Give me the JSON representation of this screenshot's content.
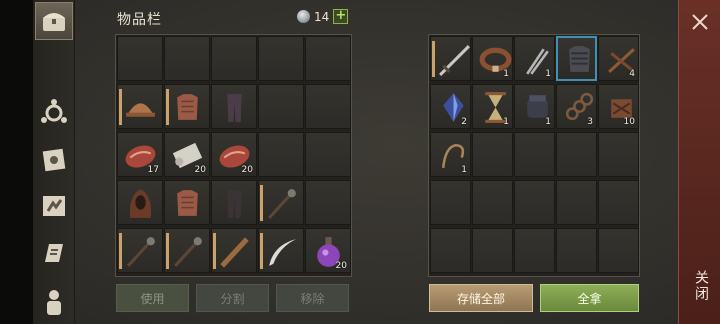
{
  "inventory": {
    "title": "物品栏",
    "coins": "14",
    "add_label": "+",
    "slots": [
      {
        "icon": "",
        "count": ""
      },
      {
        "icon": "",
        "count": ""
      },
      {
        "icon": "",
        "count": ""
      },
      {
        "icon": "",
        "count": ""
      },
      {
        "icon": "",
        "count": ""
      },
      {
        "icon": "leather-helmet-icon",
        "count": "",
        "equipped": true
      },
      {
        "icon": "leather-armor-icon",
        "count": "",
        "equipped": true
      },
      {
        "icon": "leather-pants-icon",
        "count": ""
      },
      {
        "icon": "",
        "count": ""
      },
      {
        "icon": "",
        "count": ""
      },
      {
        "icon": "raw-meat-icon",
        "count": "17"
      },
      {
        "icon": "cloth-roll-icon",
        "count": "20"
      },
      {
        "icon": "raw-meat-icon",
        "count": "20"
      },
      {
        "icon": "",
        "count": ""
      },
      {
        "icon": "",
        "count": ""
      },
      {
        "icon": "hood-icon",
        "count": ""
      },
      {
        "icon": "leather-armor-icon",
        "count": ""
      },
      {
        "icon": "dark-pants-icon",
        "count": ""
      },
      {
        "icon": "spiked-mace-icon",
        "count": "",
        "equipped": true
      },
      {
        "icon": "",
        "count": ""
      },
      {
        "icon": "spiked-mace-icon",
        "count": "",
        "equipped": true
      },
      {
        "icon": "spiked-mace-icon",
        "count": "",
        "equipped": true
      },
      {
        "icon": "wooden-club-icon",
        "count": "",
        "equipped": true
      },
      {
        "icon": "scimitar-icon",
        "count": "",
        "equipped": true
      },
      {
        "icon": "potion-icon",
        "count": "20"
      }
    ],
    "buttons": {
      "use": "使用",
      "split": "分割",
      "remove": "移除"
    }
  },
  "storage": {
    "slots": [
      {
        "icon": "sword-icon",
        "count": "",
        "equipped": true
      },
      {
        "icon": "leather-belt-icon",
        "count": "1"
      },
      {
        "icon": "tongs-icon",
        "count": "1"
      },
      {
        "icon": "chainmail-icon",
        "count": "",
        "selected": true
      },
      {
        "icon": "crossbow-bolt-icon",
        "count": "4"
      },
      {
        "icon": "crystal-icon",
        "count": "2"
      },
      {
        "icon": "hourglass-icon",
        "count": "1"
      },
      {
        "icon": "gauntlet-icon",
        "count": "1"
      },
      {
        "icon": "chain-icon",
        "count": "3"
      },
      {
        "icon": "scrap-icon",
        "count": "10"
      },
      {
        "icon": "rope-icon",
        "count": "1"
      },
      {
        "icon": "",
        "count": ""
      },
      {
        "icon": "",
        "count": ""
      },
      {
        "icon": "",
        "count": ""
      },
      {
        "icon": "",
        "count": ""
      },
      {
        "icon": "",
        "count": ""
      },
      {
        "icon": "",
        "count": ""
      },
      {
        "icon": "",
        "count": ""
      },
      {
        "icon": "",
        "count": ""
      },
      {
        "icon": "",
        "count": ""
      },
      {
        "icon": "",
        "count": ""
      },
      {
        "icon": "",
        "count": ""
      },
      {
        "icon": "",
        "count": ""
      },
      {
        "icon": "",
        "count": ""
      },
      {
        "icon": "",
        "count": ""
      }
    ],
    "buttons": {
      "store_all": "存储全部",
      "take_all": "全拿"
    }
  },
  "close": {
    "label": "关闭"
  },
  "nav": [
    "chest-icon",
    "crafting-icon",
    "sun-book-icon",
    "map-icon",
    "scroll-icon",
    "character-icon"
  ],
  "colors": {
    "accent_green": "#8fae58",
    "accent_tan": "#b89c74",
    "close_red": "#6a3026"
  }
}
